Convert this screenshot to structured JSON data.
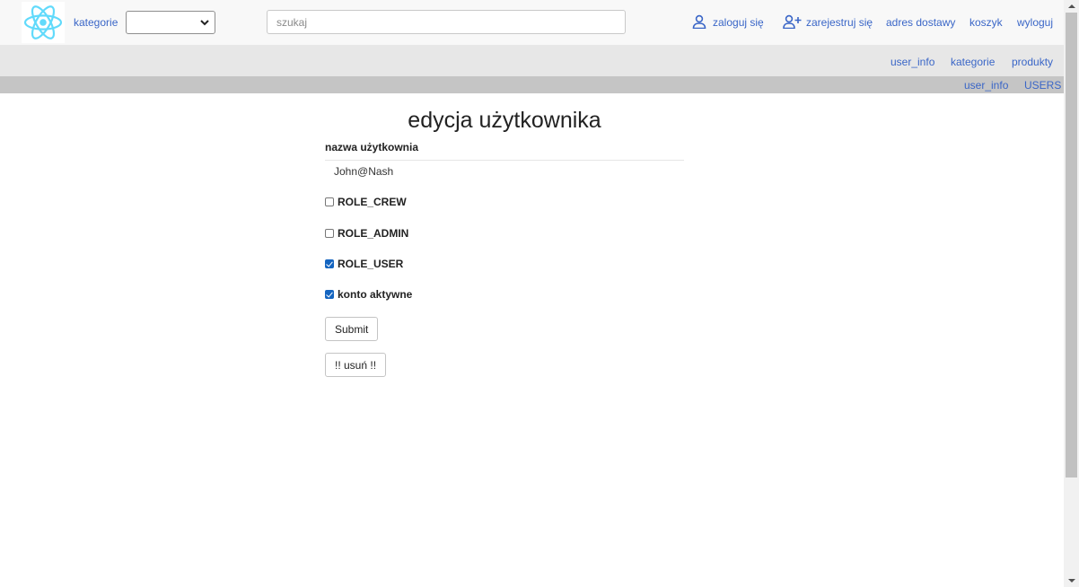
{
  "topbar": {
    "categories_label": "kategorie",
    "category_select_value": "",
    "search_placeholder": "szukaj",
    "login": "zaloguj się",
    "register": "zarejestruj się",
    "delivery": "adres dostawy",
    "cart": "koszyk",
    "logout": "wyloguj"
  },
  "subnav": {
    "items": [
      "user_info",
      "kategorie",
      "produkty"
    ]
  },
  "subnav2": {
    "items": [
      "user_info",
      "USERS"
    ]
  },
  "form": {
    "title": "edycja użytkownika",
    "username_label": "nazwa użytkownia",
    "username_value": "John@Nash",
    "checks": [
      {
        "label": "ROLE_CREW",
        "checked": false
      },
      {
        "label": "ROLE_ADMIN",
        "checked": false
      },
      {
        "label": "ROLE_USER",
        "checked": true
      },
      {
        "label": "konto aktywne",
        "checked": true
      }
    ],
    "submit_label": "Submit",
    "delete_label": "!! usuń !!"
  },
  "colors": {
    "link": "#3a66c7",
    "react_logo": "#61dafb",
    "checkbox_checked": "#1565c0"
  }
}
